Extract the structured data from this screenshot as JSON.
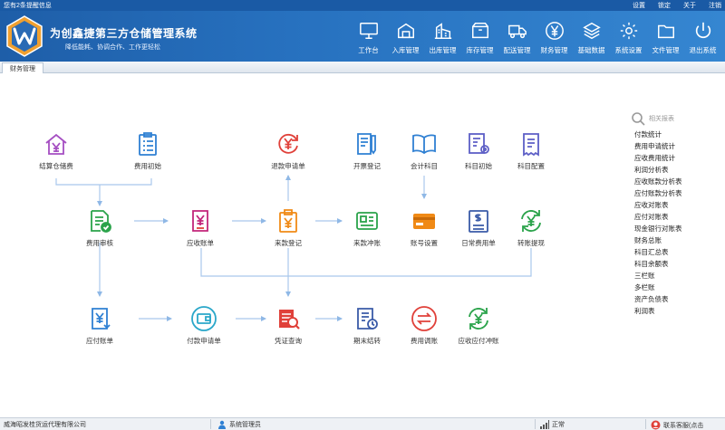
{
  "topbar": {
    "message": "您有2条提醒信息",
    "links": [
      "设置",
      "锁定",
      "关于",
      "注销"
    ]
  },
  "header": {
    "title": "为创鑫捷第三方仓储管理系统",
    "slogan": "降低能耗、协调合作、工作更轻松"
  },
  "nav": [
    {
      "id": "workbench",
      "label": "工作台",
      "icon": "monitor-icon"
    },
    {
      "id": "inbound",
      "label": "入库管理",
      "icon": "inbound-box-icon"
    },
    {
      "id": "outbound",
      "label": "出库管理",
      "icon": "outbound-building-icon"
    },
    {
      "id": "stock",
      "label": "库存管理",
      "icon": "box-icon"
    },
    {
      "id": "delivery",
      "label": "配送管理",
      "icon": "truck-icon"
    },
    {
      "id": "finance",
      "label": "财务管理",
      "icon": "yen-coin-icon"
    },
    {
      "id": "basedata",
      "label": "基础数据",
      "icon": "layers-icon"
    },
    {
      "id": "settings",
      "label": "系统设置",
      "icon": "gear-icon"
    },
    {
      "id": "files",
      "label": "文件管理",
      "icon": "folder-icon"
    },
    {
      "id": "exit",
      "label": "退出系统",
      "icon": "power-icon"
    }
  ],
  "tab": {
    "label": "财务管理"
  },
  "workflow": {
    "nodes": [
      {
        "id": "jiesuan",
        "label": "结算仓储费",
        "icon": "house-yen-icon",
        "color": "#a54ec2"
      },
      {
        "id": "feiyongchushi",
        "label": "费用初始",
        "icon": "clipboard-list-icon",
        "color": "#2f80d3"
      },
      {
        "id": "tuikuan",
        "label": "退款申请单",
        "icon": "refund-yen-icon",
        "color": "#e0413a"
      },
      {
        "id": "kaipiao",
        "label": "开票登记",
        "icon": "invoice-pen-icon",
        "color": "#2f80d3"
      },
      {
        "id": "kuaijikemu",
        "label": "会计科目",
        "icon": "open-book-icon",
        "color": "#2f80d3"
      },
      {
        "id": "kemuchushi",
        "label": "科目初始",
        "icon": "ledger-gear-icon",
        "color": "#5d5fc6"
      },
      {
        "id": "kemupeizhi",
        "label": "科目配置",
        "icon": "receipt-icon",
        "color": "#5d5fc6"
      },
      {
        "id": "feiyongshenhe",
        "label": "费用审核",
        "icon": "document-check-icon",
        "color": "#2aa34a"
      },
      {
        "id": "yingshou",
        "label": "应收账单",
        "icon": "bill-yen-icon",
        "color": "#c2267a"
      },
      {
        "id": "laikuan",
        "label": "来款登记",
        "icon": "clipboard-yen-icon",
        "color": "#f08a16"
      },
      {
        "id": "laikuanchongzhang",
        "label": "来款冲账",
        "icon": "id-card-icon",
        "color": "#2aa34a"
      },
      {
        "id": "zhanghao",
        "label": "账号设置",
        "icon": "card-icon",
        "color": "#f08a16"
      },
      {
        "id": "richang",
        "label": "日常费用单",
        "icon": "dollar-form-icon",
        "color": "#3a5ba8"
      },
      {
        "id": "zhuanzhang",
        "label": "转账提现",
        "icon": "transfer-yen-icon",
        "color": "#2aa34a"
      },
      {
        "id": "yingfu",
        "label": "应付账单",
        "icon": "bill-payable-icon",
        "color": "#2f80d3"
      },
      {
        "id": "fukuan",
        "label": "付款申请单",
        "icon": "wallet-circle-icon",
        "color": "#2aa7c9"
      },
      {
        "id": "pingzheng",
        "label": "凭证查询",
        "icon": "voucher-search-icon",
        "color": "#e0413a"
      },
      {
        "id": "qimo",
        "label": "期末结转",
        "icon": "period-end-icon",
        "color": "#3a5ba8"
      },
      {
        "id": "tiaozhang",
        "label": "费用调账",
        "icon": "adjust-circle-icon",
        "color": "#e0413a"
      },
      {
        "id": "huchong",
        "label": "应收应付冲账",
        "icon": "yen-arrows-circle-icon",
        "color": "#2aa34a"
      }
    ]
  },
  "reports": {
    "title": "相关报表",
    "items": [
      "付款统计",
      "费用申请统计",
      "应收费用统计",
      "利润分析表",
      "应收账款分析表",
      "应付账款分析表",
      "应收对账表",
      "应付对账表",
      "现金银行对账表",
      "财务总账",
      "科目汇总表",
      "科目余额表",
      "三栏账",
      "多栏账",
      "资产负债表",
      "利润表"
    ]
  },
  "status": {
    "company": "威海昭发桂货运代理有限公司",
    "user": "系统管理员",
    "network": "正常",
    "support": "联系客服(点击"
  }
}
